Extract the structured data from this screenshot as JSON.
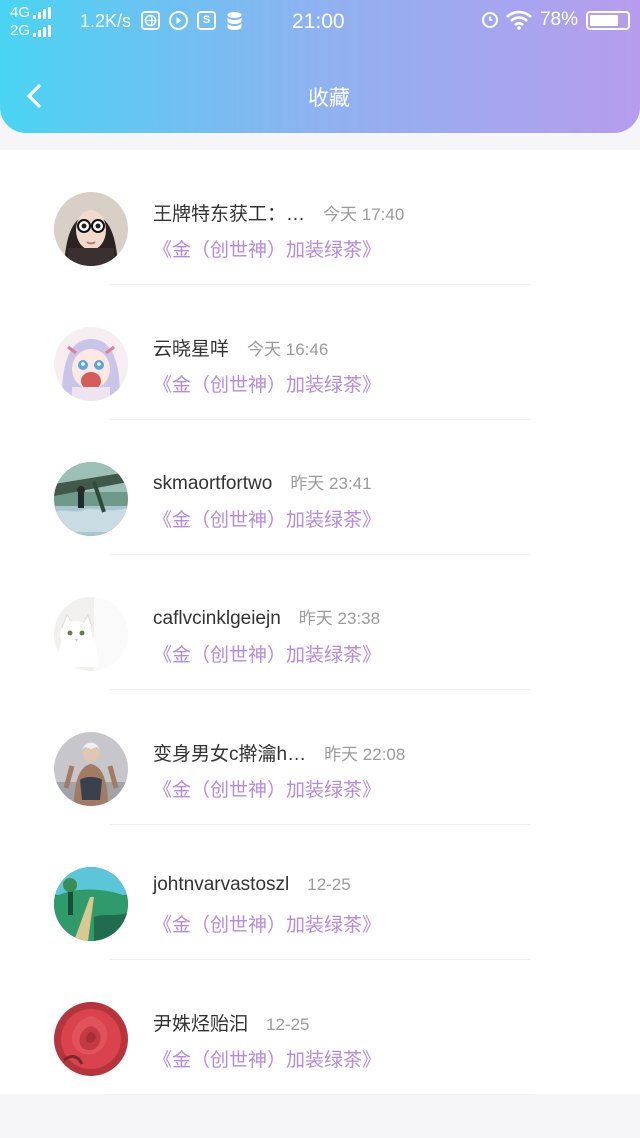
{
  "status_bar": {
    "network_top": "4G",
    "network_bottom": "2G",
    "speed": "1.2K/s",
    "time": "21:00",
    "battery": "78%",
    "battery_level": 0.78,
    "app_icons": [
      "browser-icon",
      "media-icon",
      "s-app-icon",
      "database-icon"
    ],
    "s_icon_letter": "S"
  },
  "nav": {
    "back_icon": "chevron-left-icon",
    "title": "收藏"
  },
  "colors": {
    "header_gradient_start": "#49d4f2",
    "header_gradient_end": "#b79cee",
    "link": "#b48be0",
    "name": "#333333",
    "time": "#9b9b9b"
  },
  "items": [
    {
      "name": "王牌特东获工：…",
      "time": "今天 17:40",
      "book": "《金（创世神）加装绿茶》",
      "avatar": "avatar-girl-sunglasses"
    },
    {
      "name": "云晓星咩",
      "time": "今天 16:46",
      "book": "《金（创世神）加装绿茶》",
      "avatar": "avatar-anime-girl"
    },
    {
      "name": "skmaortfortwo",
      "time": "昨天 23:41",
      "book": "《金（创世神）加装绿茶》",
      "avatar": "avatar-nature-scene"
    },
    {
      "name": "caflvcinklgeiejn",
      "time": "昨天 23:38",
      "book": "《金（创世神）加装绿茶》",
      "avatar": "avatar-white-cat"
    },
    {
      "name": "变身男女c擀瀹h…",
      "time": "昨天 22:08",
      "book": "《金（创世神）加装绿茶》",
      "avatar": "avatar-tattoo-man"
    },
    {
      "name": "johtnvarvastoszl",
      "time": "12-25",
      "book": "《金（创世神）加装绿茶》",
      "avatar": "avatar-green-landscape"
    },
    {
      "name": "尹姝烃贻汩",
      "time": "12-25",
      "book": "《金（创世神）加装绿茶》",
      "avatar": "avatar-red-rose"
    }
  ]
}
